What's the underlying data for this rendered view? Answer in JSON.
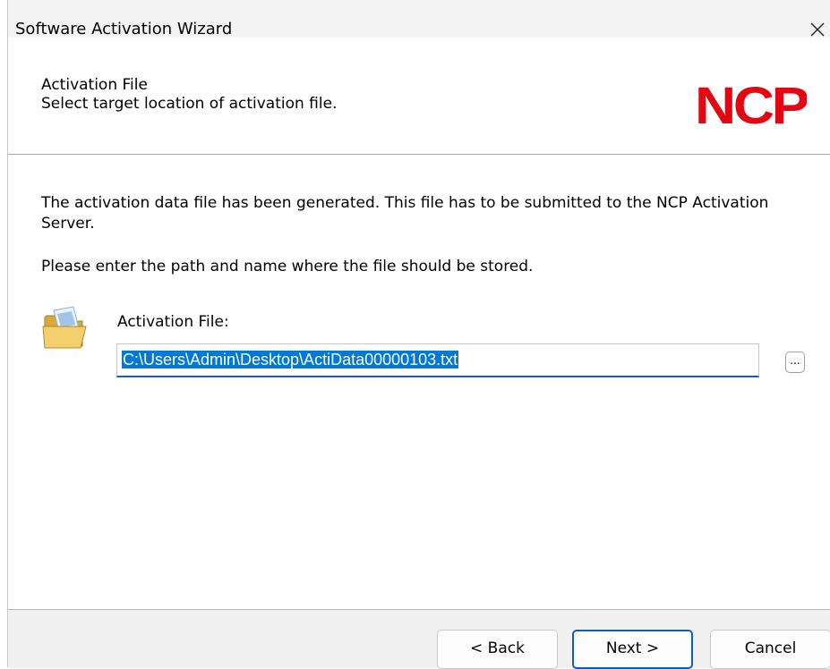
{
  "window": {
    "title": "Software Activation Wizard",
    "close_icon": "close-icon"
  },
  "header": {
    "title": "Activation File",
    "subtitle": "Select target location of activation file.",
    "logo_text": "NCP",
    "logo_color": "#e30613"
  },
  "content": {
    "message": "The activation data file has been generated. This file has to be submitted to the NCP Activation Server.",
    "instruction": "Please enter the path and name where the file should be stored.",
    "field_label": "Activation File:",
    "field_value": "C:\\Users\\Admin\\Desktop\\ActiData00000103.txt",
    "browse_label": "...",
    "folder_icon": "open-folder-icon"
  },
  "footer": {
    "back_label": "< Back",
    "next_label": "Next >",
    "cancel_label": "Cancel"
  },
  "colors": {
    "accent": "#0f5fb5",
    "selection": "#0078d7"
  }
}
